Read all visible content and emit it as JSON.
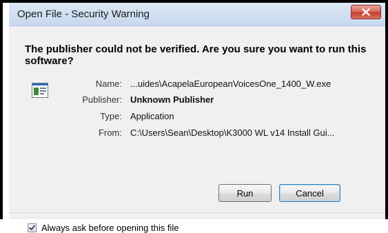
{
  "dialog": {
    "title": "Open File - Security Warning",
    "headline": "The publisher could not be verified.  Are you sure you want to run this software?"
  },
  "fields": {
    "name_label": "Name:",
    "name_value": "...uides\\AcapelaEuropeanVoicesOne_1400_W.exe",
    "publisher_label": "Publisher:",
    "publisher_value": "Unknown Publisher",
    "type_label": "Type:",
    "type_value": "Application",
    "from_label": "From:",
    "from_value": "C:\\Users\\Sean\\Desktop\\K3000 WL v14 Install Gui..."
  },
  "buttons": {
    "run_label": "Run",
    "cancel_label": "Cancel"
  },
  "checkbox": {
    "label": "Always ask before opening this file",
    "checked": true
  },
  "icons": {
    "close": "close-icon",
    "file": "file-icon",
    "check": "checkmark-icon"
  },
  "colors": {
    "close_button": "#c2402f",
    "title_bar": "#c8d9ee",
    "dialog_bg": "#f0f0f0",
    "cancel_focus": "#3c7fb1"
  }
}
